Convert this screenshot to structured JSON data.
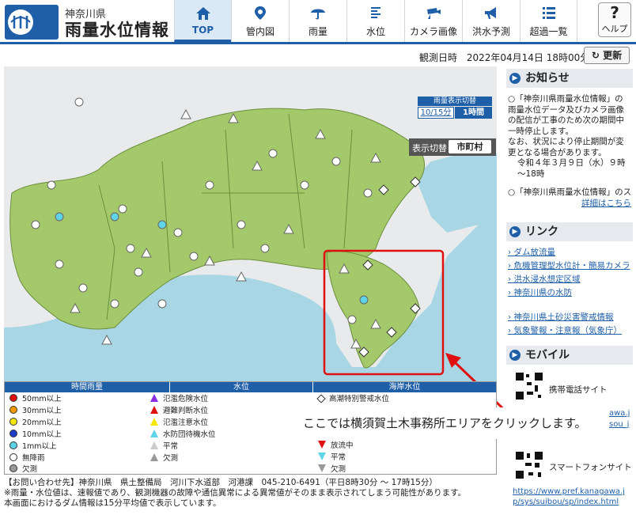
{
  "header": {
    "prefecture": "神奈川県",
    "site_title": "雨量水位情報"
  },
  "nav": [
    {
      "label": "TOP",
      "icon": "home-icon"
    },
    {
      "label": "管内図",
      "icon": "map-pin-icon"
    },
    {
      "label": "雨量",
      "icon": "umbrella-icon"
    },
    {
      "label": "水位",
      "icon": "water-level-icon"
    },
    {
      "label": "カメラ画像",
      "icon": "camera-icon"
    },
    {
      "label": "洪水予測",
      "icon": "megaphone-icon"
    },
    {
      "label": "超過一覧",
      "icon": "list-icon"
    }
  ],
  "help": {
    "symbol": "?",
    "label": "ヘルプ"
  },
  "observation": {
    "label": "観測日時",
    "datetime": "2022年04月14日 18時00分",
    "refresh_label": "更新"
  },
  "map": {
    "display_switch_label": "表示切替",
    "display_switch_value": "市町村",
    "rain_switch_title": "雨量表示切替",
    "rain_switch_option_1": "10/15分",
    "rain_switch_option_2": "1時間"
  },
  "legend": {
    "rain": {
      "title": "時間雨量",
      "items": [
        {
          "label": "50mm以上",
          "color": "#e01010"
        },
        {
          "label": "30mm以上",
          "color": "#f39800"
        },
        {
          "label": "20mm以上",
          "color": "#f7e600"
        },
        {
          "label": "10mm以上",
          "color": "#1e3cc8"
        },
        {
          "label": "1mm以上",
          "color": "#5fd3e8"
        },
        {
          "label": "無降雨",
          "color": "#ffffff"
        },
        {
          "label": "欠測",
          "color": "#999999"
        }
      ]
    },
    "water": {
      "title": "水位",
      "items": [
        {
          "label": "氾濫危険水位",
          "color": "#8a2be2"
        },
        {
          "label": "避難判断水位",
          "color": "#e01010"
        },
        {
          "label": "氾濫注意水位",
          "color": "#f7e600"
        },
        {
          "label": "水防団待機水位",
          "color": "#5fd3e8"
        },
        {
          "label": "平常",
          "color": "#ffffff"
        },
        {
          "label": "欠測",
          "color": "#999999"
        }
      ]
    },
    "coast": {
      "title": "海岸水位",
      "items": [
        {
          "label": "高潮特別警戒水位",
          "color": "#333333"
        },
        {
          "label": "放流中",
          "color": "#e01010"
        },
        {
          "label": "平常",
          "color": "#5fd3e8"
        },
        {
          "label": "欠測",
          "color": "#999999"
        }
      ]
    }
  },
  "footer": {
    "line1": "【お問い合わせ先】神奈川県　県土整備局　河川下水道部　河港課　045-210-6491（平日8時30分 ～ 17時15分）",
    "line2": "※雨量・水位値は、速報値であり、観測機器の故障や通信異常による異常値がそのまま表示されてしまう可能性があります。",
    "line3": "本画面におけるダム情報は15分平均値で表示しています。"
  },
  "sidebar": {
    "notice": {
      "title": "お知らせ",
      "text1": "○「神奈川県雨量水位情報」の雨量水位データ及びカメラ画像の配信が工事のため次の期間中一時停止します。",
      "text2": "なお、状況により停止期間が変更となる場合があります。",
      "text3": "令和４年３月９日（水）９時～18時",
      "text4": "○「神奈川県雨量水位情報」のス",
      "more_link": "詳細はこちら"
    },
    "links": {
      "title": "リンク",
      "items": [
        "ダム放流量",
        "危機管理型水位計・簡易カメラ",
        "洪水浸水想定区域",
        "神奈川県の水防",
        "神奈川県土砂災害警戒情報",
        "気象警報・注意報（気象庁）"
      ]
    },
    "mobile": {
      "title": "モバイル",
      "mobile_label": "携帯電話サイト",
      "mobile_url_fragment": "awa.j",
      "mobile_url_fragment2": "sou_j",
      "smartphone_label": "スマートフォンサイト",
      "smartphone_url": "https://www.pref.kanagawa.jp/sys/suibou/sp/index.html"
    }
  },
  "callout": {
    "text": "ここでは横須賀土木事務所エリアをクリックします。"
  }
}
